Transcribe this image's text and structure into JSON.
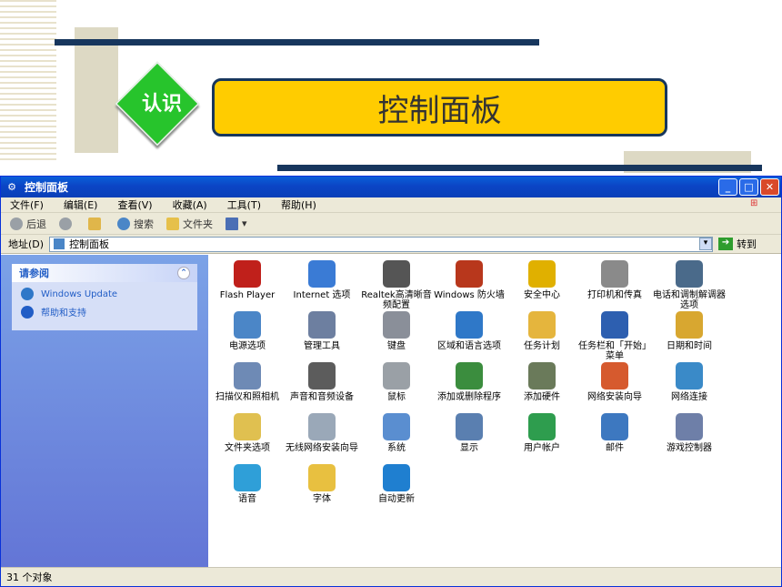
{
  "slide": {
    "badge": "认识",
    "title": "控制面板"
  },
  "window": {
    "title": "控制面板",
    "menu": [
      "文件(F)",
      "编辑(E)",
      "查看(V)",
      "收藏(A)",
      "工具(T)",
      "帮助(H)"
    ],
    "toolbar": {
      "back": "后退",
      "search": "搜索",
      "folders": "文件夹"
    },
    "address": {
      "label": "地址(D)",
      "value": "控制面板",
      "go": "转到"
    },
    "sidebar": {
      "heading": "请参阅",
      "links": [
        "Windows Update",
        "帮助和支持"
      ]
    },
    "items": [
      "Flash Player",
      "Internet 选项",
      "Realtek高清晰音频配置",
      "Windows 防火墙",
      "安全中心",
      "打印机和传真",
      "电话和调制解调器选项",
      "电源选项",
      "管理工具",
      "键盘",
      "区域和语言选项",
      "任务计划",
      "任务栏和「开始」菜单",
      "日期和时间",
      "扫描仪和照相机",
      "声音和音频设备",
      "鼠标",
      "添加或删除程序",
      "添加硬件",
      "网络安装向导",
      "网络连接",
      "文件夹选项",
      "无线网络安装向导",
      "系统",
      "显示",
      "用户帐户",
      "邮件",
      "游戏控制器",
      "语音",
      "字体",
      "自动更新"
    ],
    "icon_colors": [
      "#c0201b",
      "#3a7bd5",
      "#555555",
      "#b8371c",
      "#e0b000",
      "#8a8a8a",
      "#4a6a8a",
      "#4b86c7",
      "#6d7fa0",
      "#8a8f99",
      "#2f78c8",
      "#e5b53d",
      "#2d5fb0",
      "#d8a730",
      "#6e8ab5",
      "#5c5c5c",
      "#9aa0a6",
      "#3b8d3e",
      "#6a7a5a",
      "#d65a2e",
      "#3a8ac8",
      "#e0c050",
      "#9aa8b8",
      "#5a8ed0",
      "#5a7fb0",
      "#2e9d4e",
      "#3d78c0",
      "#6e7fa8",
      "#2f9fd8",
      "#e8c040",
      "#1f7fd0"
    ],
    "status": "31 个对象"
  }
}
